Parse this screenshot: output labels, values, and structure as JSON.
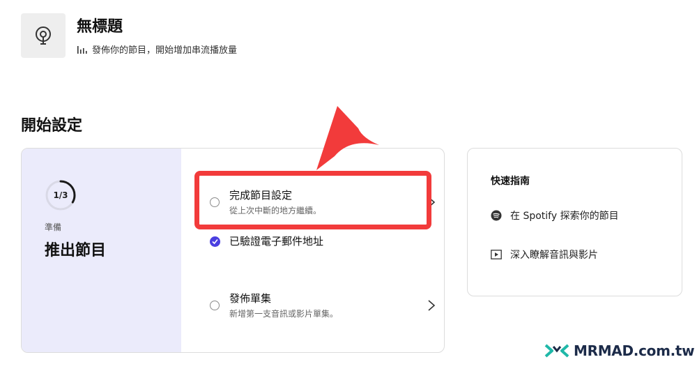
{
  "show": {
    "title": "無標題",
    "subtitle": "發佈你的節目，開始增加串流播放量",
    "cover_icon": "podcast-icon",
    "subtitle_icon": "bar-chart-icon"
  },
  "setup": {
    "section_title": "開始設定",
    "progress": {
      "text": "1/3",
      "completed": 1,
      "total": 3,
      "stage_label": "準備",
      "stage_title": "推出節目",
      "accent_color": "#1a1a1a",
      "panel_color": "#ebebfb"
    },
    "tasks": [
      {
        "title": "完成節目設定",
        "description": "從上次中斷的地方繼續。",
        "status": "pending",
        "icon": "radio-empty-icon",
        "action_icon": "chevron-right-icon"
      },
      {
        "title": "已驗證電子郵件地址",
        "description": "",
        "status": "done",
        "icon": "check-circle-icon",
        "check_color": "#4a3fe0"
      },
      {
        "title": "發佈單集",
        "description": "新增第一支音訊或影片單集。",
        "status": "pending",
        "icon": "radio-empty-icon",
        "action_icon": "chevron-right-icon"
      }
    ]
  },
  "annotation": {
    "color": "#f23b3b",
    "target": "完成節目設定"
  },
  "guide": {
    "title": "快速指南",
    "items": [
      {
        "label": "在 Spotify 探索你的節目",
        "icon": "spotify-icon"
      },
      {
        "label": "深入瞭解音訊與影片",
        "icon": "play-video-icon"
      }
    ]
  },
  "watermark": {
    "text": "MRMAD.com.tw",
    "logo_colors": [
      "#1fb8a8",
      "#1c2b49"
    ]
  }
}
